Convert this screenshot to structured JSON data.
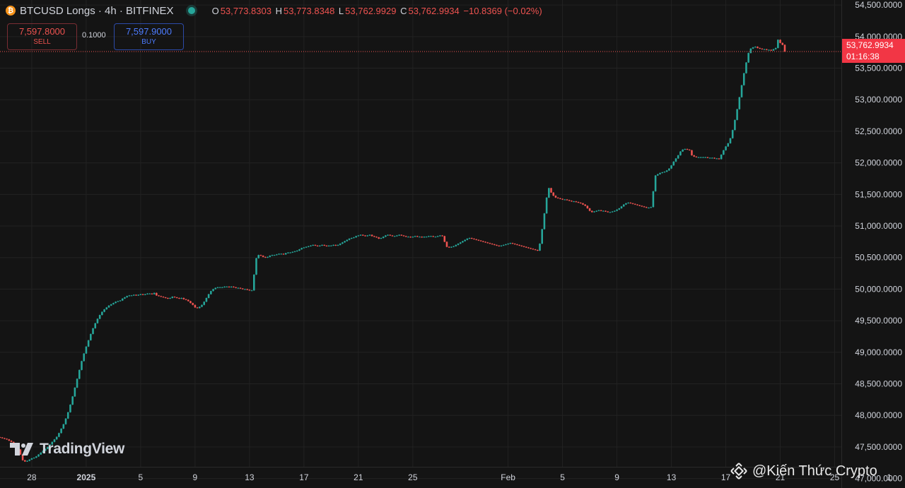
{
  "header": {
    "title": "BTCUSD Longs · 4h · BITFINEX",
    "coin_glyph": "₿",
    "ohlc": {
      "o_label": "O",
      "o": "53,773.8303",
      "h_label": "H",
      "h": "53,773.8348",
      "l_label": "L",
      "l": "53,762.9929",
      "c_label": "C",
      "c": "53,762.9934",
      "change": "−10.8369 (−0.02%)"
    }
  },
  "trade": {
    "sell_price": "7,597.8000",
    "sell_label": "SELL",
    "quantity": "0.1000",
    "buy_price": "7,597.9000",
    "buy_label": "BUY"
  },
  "logo": {
    "text": "TradingView",
    "icon": "tradingview-logo-icon"
  },
  "watermark": {
    "text": "@Kiến Thức Crypto",
    "icon": "binance-logo-icon"
  },
  "last_price": {
    "value": "53,762.9934",
    "countdown": "01:16:38"
  },
  "colors": {
    "background": "#141414",
    "up": "#26a69a",
    "down": "#ef5350",
    "price_tag": "#f23645",
    "grid": "#222222"
  },
  "chart_data": {
    "type": "candlestick",
    "title": "BTCUSD Longs · 4h · BITFINEX",
    "ylim": [
      46850,
      54580
    ],
    "y_ticks": [
      54500,
      54000,
      53500,
      53000,
      52500,
      52000,
      51500,
      51000,
      50500,
      50000,
      49500,
      49000,
      48500,
      48000,
      47500,
      47000
    ],
    "y_tick_labels": [
      "54,500.0000",
      "54,000.0000",
      "53,500.0000",
      "53,000.0000",
      "52,500.0000",
      "52,000.0000",
      "51,500.0000",
      "51,000.0000",
      "50,500.0000",
      "50,000.0000",
      "49,500.0000",
      "49,000.0000",
      "48,500.0000",
      "48,000.0000",
      "47,500.0000",
      "47,000.0000"
    ],
    "x_tick_labels": [
      "28",
      "2025",
      "5",
      "9",
      "13",
      "17",
      "21",
      "25",
      "Feb",
      "5",
      "9",
      "13",
      "17",
      "21",
      "25",
      "1"
    ],
    "x_tick_dates": [
      "2024-12-28",
      "2025-01-01",
      "2025-01-05",
      "2025-01-09",
      "2025-01-13",
      "2025-01-17",
      "2025-01-21",
      "2025-01-25",
      "2025-02-01",
      "2025-02-05",
      "2025-02-09",
      "2025-02-13",
      "2025-02-17",
      "2025-02-21",
      "2025-02-25",
      "2025-03-01"
    ],
    "x_range": [
      "2024-12-25T16:00",
      "2025-03-02T04:00"
    ],
    "interval_hours": 4,
    "series_start": "2024-12-25T16:00",
    "close": [
      47650,
      47640,
      47630,
      47620,
      47600,
      47580,
      47560,
      47540,
      47460,
      47380,
      47290,
      47270,
      47280,
      47300,
      47320,
      47330,
      47350,
      47380,
      47410,
      47440,
      47470,
      47500,
      47540,
      47580,
      47620,
      47660,
      47720,
      47790,
      47860,
      47950,
      48050,
      48170,
      48300,
      48440,
      48580,
      48720,
      48860,
      48980,
      49090,
      49190,
      49290,
      49380,
      49460,
      49530,
      49590,
      49640,
      49680,
      49710,
      49740,
      49760,
      49780,
      49800,
      49810,
      49820,
      49850,
      49870,
      49890,
      49900,
      49900,
      49910,
      49900,
      49910,
      49920,
      49910,
      49920,
      49930,
      49930,
      49920,
      49940,
      49900,
      49890,
      49880,
      49870,
      49860,
      49850,
      49860,
      49880,
      49870,
      49860,
      49850,
      49860,
      49840,
      49830,
      49810,
      49780,
      49750,
      49710,
      49700,
      49720,
      49750,
      49800,
      49860,
      49920,
      49970,
      50000,
      50020,
      50030,
      50030,
      50030,
      50040,
      50040,
      50030,
      50040,
      50030,
      50020,
      50020,
      50010,
      50000,
      50000,
      49990,
      49980,
      49980,
      50230,
      50490,
      50540,
      50530,
      50510,
      50500,
      50510,
      50530,
      50540,
      50540,
      50550,
      50560,
      50560,
      50550,
      50570,
      50580,
      50580,
      50590,
      50600,
      50610,
      50630,
      50650,
      50660,
      50670,
      50680,
      50690,
      50700,
      50690,
      50680,
      50690,
      50700,
      50690,
      50680,
      50690,
      50690,
      50700,
      50690,
      50700,
      50720,
      50740,
      50760,
      50780,
      50800,
      50810,
      50820,
      50840,
      50850,
      50860,
      50850,
      50840,
      50850,
      50860,
      50840,
      50830,
      50820,
      50800,
      50810,
      50830,
      50850,
      50860,
      50850,
      50840,
      50840,
      50850,
      50860,
      50850,
      50840,
      50830,
      50830,
      50820,
      50830,
      50840,
      50830,
      50830,
      50820,
      50830,
      50830,
      50840,
      50840,
      50830,
      50830,
      50840,
      50850,
      50840,
      50750,
      50670,
      50660,
      50670,
      50680,
      50700,
      50720,
      50740,
      50760,
      50780,
      50800,
      50810,
      50800,
      50790,
      50780,
      50770,
      50760,
      50750,
      50740,
      50730,
      50720,
      50710,
      50700,
      50690,
      50680,
      50690,
      50700,
      50710,
      50720,
      50730,
      50720,
      50710,
      50700,
      50690,
      50680,
      50670,
      50660,
      50650,
      50640,
      50630,
      50620,
      50610,
      50720,
      50950,
      51200,
      51450,
      51600,
      51530,
      51480,
      51450,
      51440,
      51430,
      51420,
      51420,
      51410,
      51400,
      51390,
      51390,
      51380,
      51370,
      51360,
      51340,
      51320,
      51280,
      51240,
      51220,
      51230,
      51240,
      51250,
      51240,
      51240,
      51230,
      51220,
      51220,
      51230,
      51240,
      51260,
      51280,
      51310,
      51340,
      51360,
      51370,
      51360,
      51350,
      51340,
      51330,
      51320,
      51310,
      51300,
      51290,
      51290,
      51300,
      51550,
      51800,
      51820,
      51840,
      51850,
      51860,
      51880,
      51910,
      51960,
      52020,
      52070,
      52120,
      52180,
      52210,
      52220,
      52210,
      52200,
      52120,
      52100,
      52090,
      52090,
      52090,
      52090,
      52090,
      52080,
      52080,
      52080,
      52070,
      52070,
      52060,
      52130,
      52200,
      52260,
      52310,
      52390,
      52520,
      52680,
      52850,
      53040,
      53230,
      53420,
      53590,
      53740,
      53810,
      53830,
      53840,
      53820,
      53810,
      53800,
      53800,
      53790,
      53790,
      53780,
      53800,
      53820,
      53950,
      53900,
      53870,
      53763
    ]
  }
}
